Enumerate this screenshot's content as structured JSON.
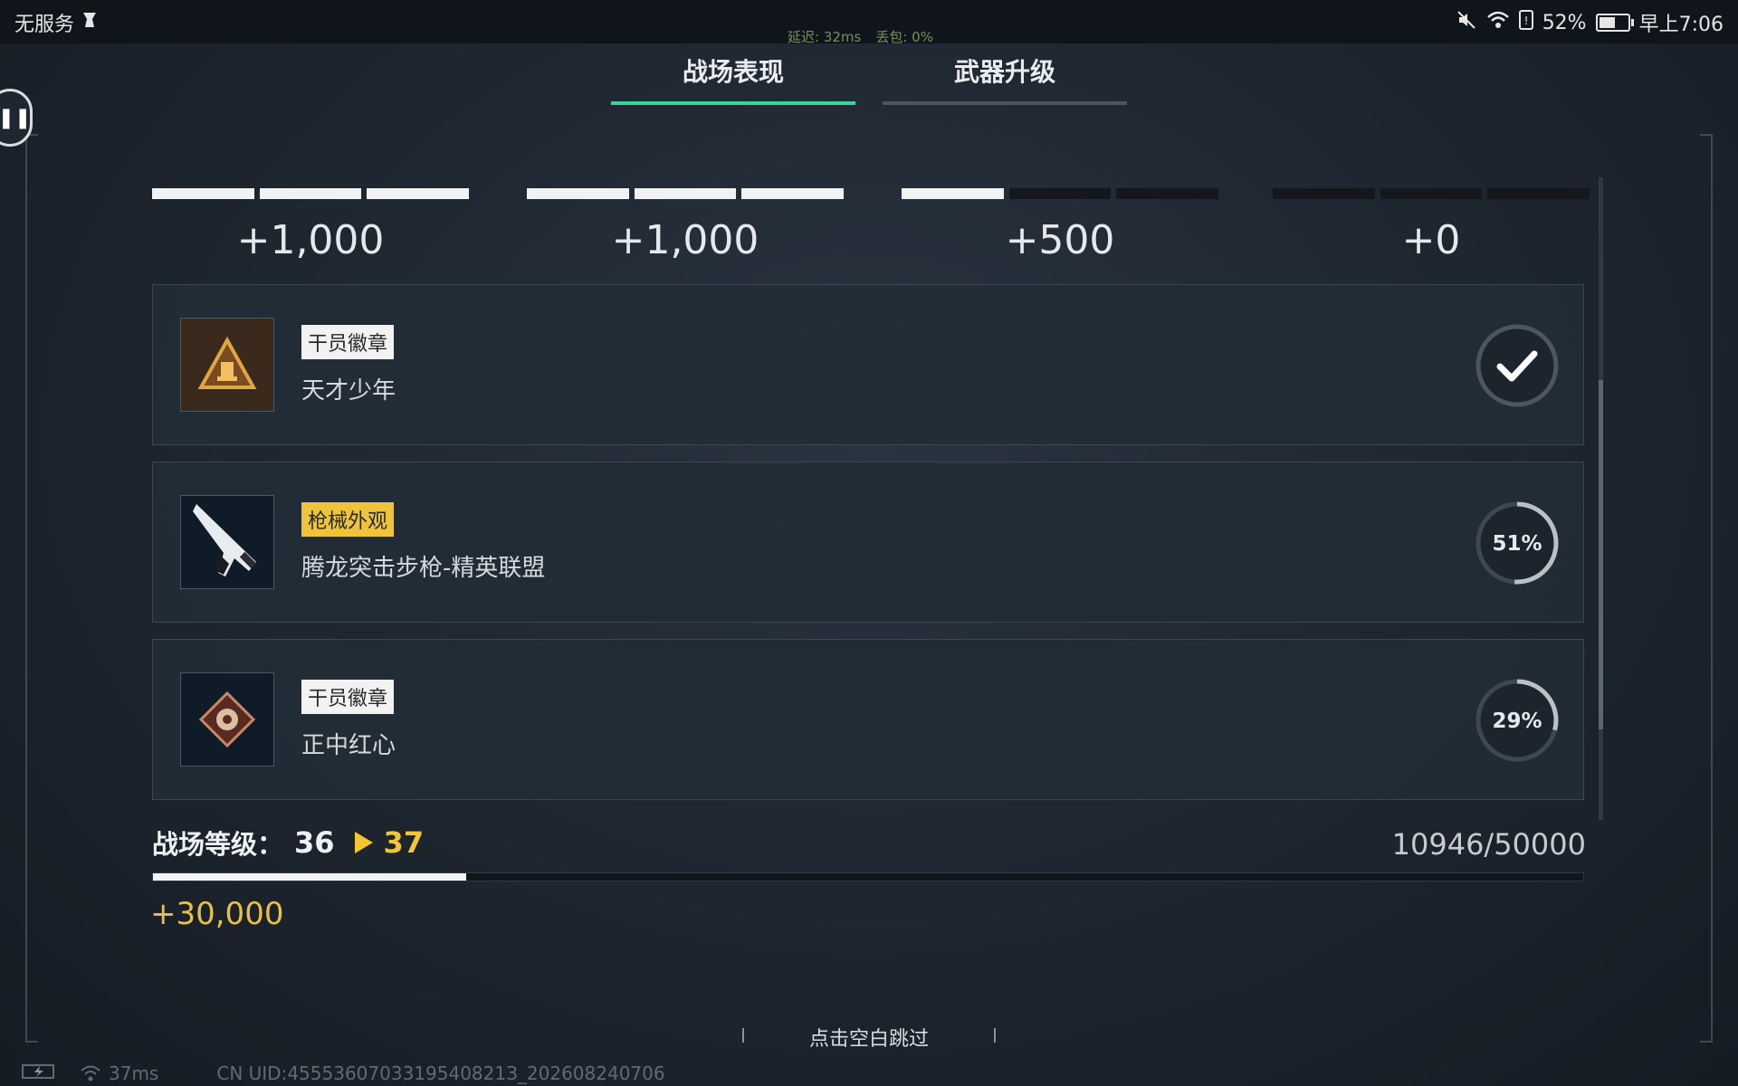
{
  "status_bar": {
    "carrier": "无服务",
    "battery_percent": "52%",
    "time": "早上7:06"
  },
  "network_overlay": {
    "latency": "延迟: 32ms",
    "packet_loss": "丢包: 0%"
  },
  "tabs": [
    {
      "label": "战场表现",
      "active": true
    },
    {
      "label": "武器升级",
      "active": false
    }
  ],
  "score_segments": [
    {
      "amount": "+1,000",
      "filled_fraction": 1.0
    },
    {
      "amount": "+1,000",
      "filled_fraction": 1.0
    },
    {
      "amount": "+500",
      "filled_fraction": 0.333
    },
    {
      "amount": "+0",
      "filled_fraction": 0.0
    }
  ],
  "rewards": [
    {
      "badge": "干员徽章",
      "badge_color": "#f2f2f2",
      "name": "天才少年",
      "status": "completed",
      "progress_fraction": 1.0,
      "progress_text": ""
    },
    {
      "badge": "枪械外观",
      "badge_color": "#f0c43a",
      "name": "腾龙突击步枪-精英联盟",
      "status": "in-progress",
      "progress_fraction": 0.51,
      "progress_text": "51%"
    },
    {
      "badge": "干员徽章",
      "badge_color": "#f2f2f2",
      "name": "正中红心",
      "status": "in-progress",
      "progress_fraction": 0.29,
      "progress_text": "29%"
    }
  ],
  "battlefield_level": {
    "label": "战场等级：",
    "current": "36",
    "next": "37",
    "xp_text": "10946/50000",
    "progress_fraction": 0.219,
    "gain": "+30,000"
  },
  "skip_hint": "点击空白跳过",
  "footer": {
    "ping": "37ms",
    "uid": "CN UID:4555360703319540821З_202608240706"
  },
  "colors": {
    "accent_tab": "#35d69a",
    "level_next": "#f2c531",
    "gain": "#e8bf48"
  }
}
